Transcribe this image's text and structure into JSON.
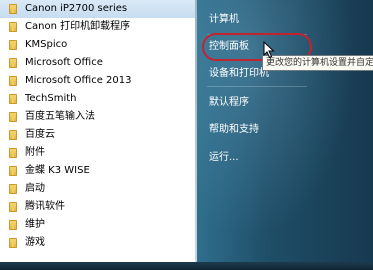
{
  "programs": [
    {
      "label": "Canon iP2700 series",
      "selected": true
    },
    {
      "label": "Canon 打印机卸载程序"
    },
    {
      "label": "KMSpico"
    },
    {
      "label": "Microsoft Office"
    },
    {
      "label": "Microsoft Office 2013"
    },
    {
      "label": "TechSmith"
    },
    {
      "label": "百度五笔输入法"
    },
    {
      "label": "百度云"
    },
    {
      "label": "附件"
    },
    {
      "label": "金蝶 K3 WISE"
    },
    {
      "label": "启动"
    },
    {
      "label": "腾讯软件"
    },
    {
      "label": "维护"
    },
    {
      "label": "游戏"
    }
  ],
  "right_menu": {
    "computer": "计算机",
    "control_panel": "控制面板",
    "devices_printers": "设备和打印机",
    "default_programs": "默认程序",
    "help_support": "帮助和支持",
    "run": "运行..."
  },
  "tooltip": "更改您的计算机设置并自定",
  "colors": {
    "highlight_ring": "#c3232f",
    "right_panel": "#1f4e68"
  },
  "icons": {
    "folder": "folder-icon",
    "cursor": "mouse-pointer-icon"
  }
}
